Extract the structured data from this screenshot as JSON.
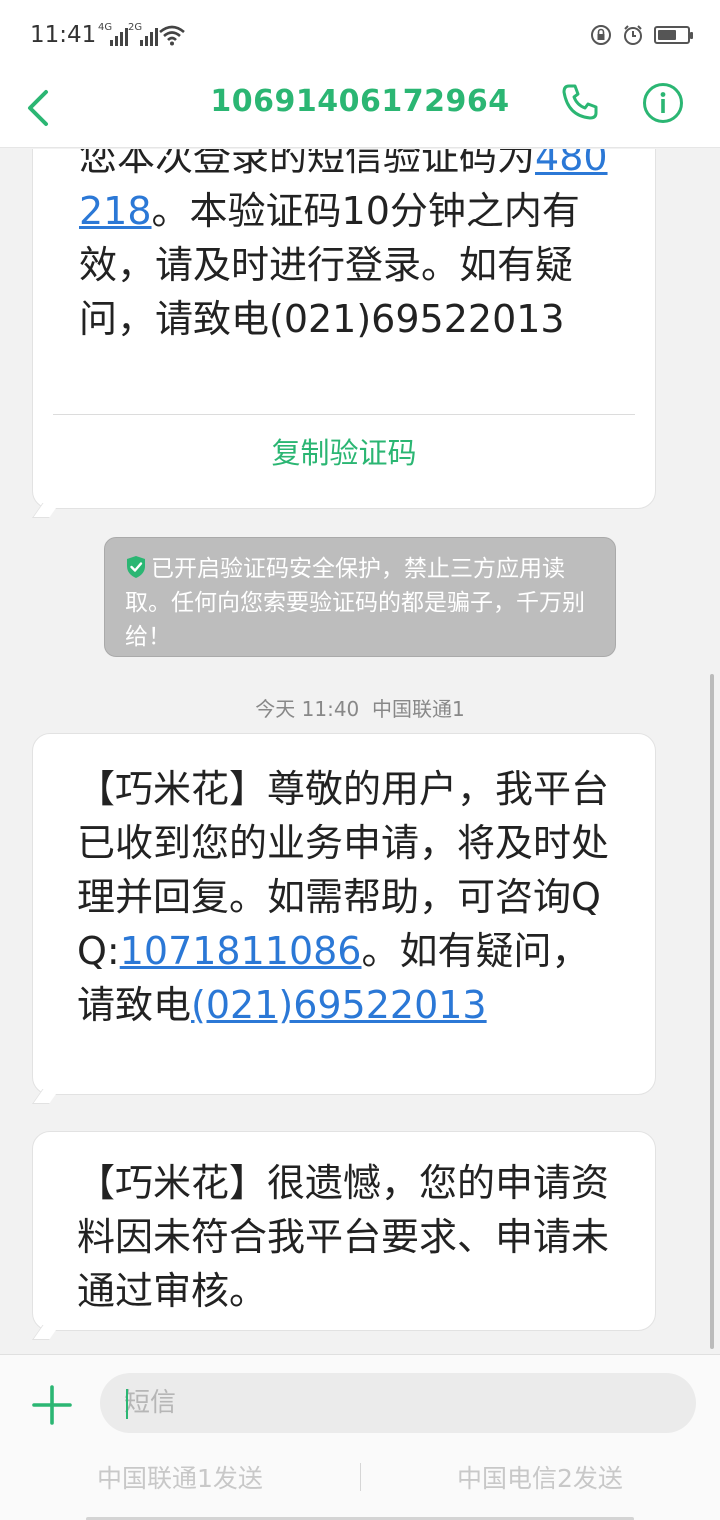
{
  "status": {
    "time": "11:41",
    "net1": "4G",
    "net2": "2G"
  },
  "header": {
    "title": "10691406172964",
    "icons": [
      "back-arrow-icon",
      "phone-icon",
      "info-icon"
    ],
    "accent_color": "#2bb673"
  },
  "messages": [
    {
      "segments": [
        "您本次登录的短信验证码为",
        "480218",
        "。本验证码10分钟之内有效，请及时进行登录。如有疑问，请致电(021)69522013"
      ],
      "action": "复制验证码"
    },
    {
      "segments": [
        "【巧米花】尊敬的用户，我平台已收到您的业务申请，将及时处理并回复。如需帮助，可咨询QQ:",
        "1071811086",
        "。如有疑问，请致电",
        "(021)69522013"
      ]
    },
    {
      "segments": [
        "【巧米花】很遗憾，您的申请资料因未符合我平台要求、申请未通过审核。"
      ]
    }
  ],
  "notice": {
    "text": "已开启验证码安全保护，禁止三方应用读取。任何向您索要验证码的都是骗子，千万别给！"
  },
  "timestamp": {
    "day": "今天",
    "time": "11:40",
    "carrier": "中国联通1"
  },
  "composer": {
    "placeholder": "短信",
    "send1": "中国联通1发送",
    "send2": "中国电信2发送"
  },
  "colors": {
    "link": "#2b78d6",
    "notice_bg": "#bdbdbd"
  }
}
